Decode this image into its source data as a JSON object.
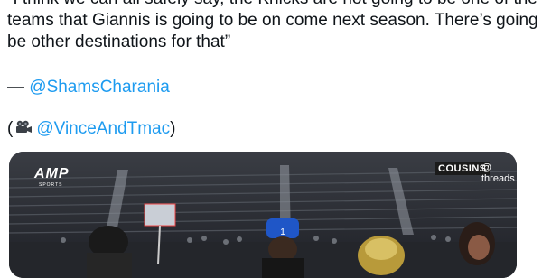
{
  "tweet": {
    "lines": [
      "“I think we can all safely say, the Knicks are not going to be one of the",
      "teams that Giannis is going to be on come next season. There’s going to",
      "be other destinations for that”"
    ],
    "credit_dash": "— ",
    "credit_handle": "@ShamsCharania",
    "video_open": "(",
    "video_handle": "@VinceAndTmac",
    "video_close": ")"
  },
  "media": {
    "logo_main": "AMP",
    "logo_sub": "SPORTS",
    "watermark_left": "COUSINS",
    "watermark_right": "threads",
    "jersey_number": "1"
  },
  "icons": {
    "camera": "movie-camera-icon"
  },
  "colors": {
    "link": "#1d9bf0",
    "text": "#0f1419"
  }
}
